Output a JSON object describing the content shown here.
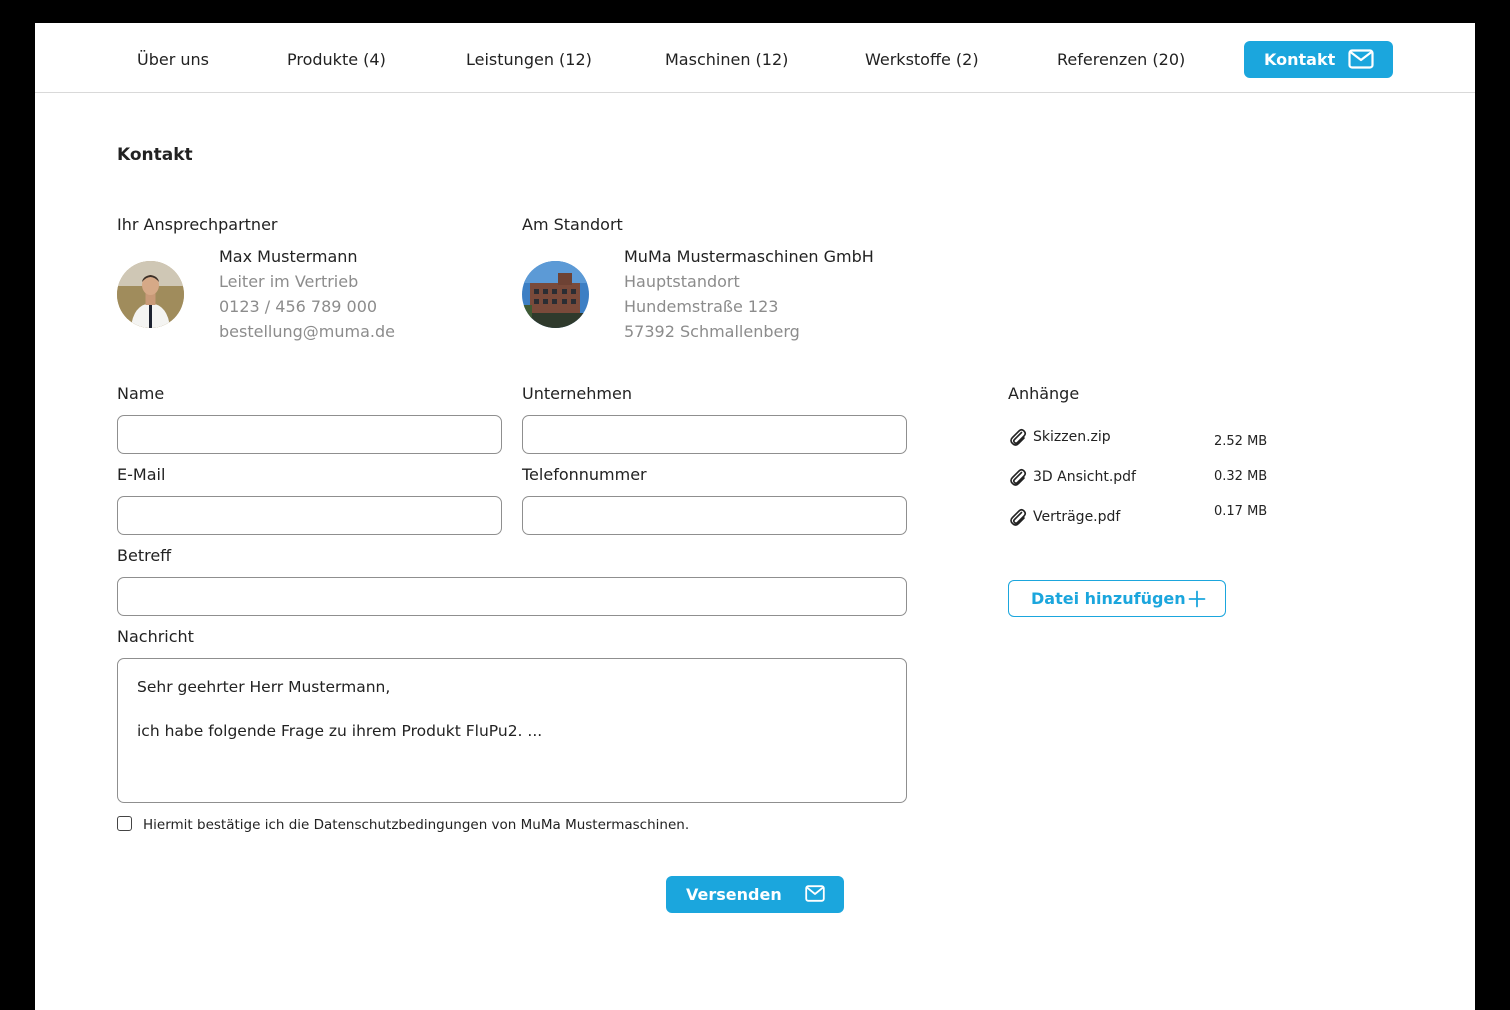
{
  "nav": {
    "items": [
      {
        "label": "Über uns"
      },
      {
        "label": "Produkte (4)"
      },
      {
        "label": "Leistungen (12)"
      },
      {
        "label": "Maschinen (12)"
      },
      {
        "label": "Werkstoffe (2)"
      },
      {
        "label": "Referenzen (20)"
      }
    ],
    "kontakt_label": "Kontakt",
    "kontakt_icon": "envelope-icon",
    "accent_color": "#1ba6dd"
  },
  "page": {
    "title": "Kontakt"
  },
  "contact_person": {
    "heading": "Ihr Ansprechpartner",
    "name": "Max Mustermann",
    "role": "Leiter im Vertrieb",
    "phone": "0123 / 456 789 000",
    "email": "bestellung@muma.de"
  },
  "location": {
    "heading": "Am Standort",
    "company": "MuMa Mustermaschinen GmbH",
    "site": "Hauptstandort",
    "street": "Hundemstraße 123",
    "city": "57392 Schmallenberg"
  },
  "form": {
    "name_label": "Name",
    "company_label": "Unternehmen",
    "email_label": "E-Mail",
    "phone_label": "Telefonnummer",
    "subject_label": "Betreff",
    "message_label": "Nachricht",
    "name_value": "",
    "company_value": "",
    "email_value": "",
    "phone_value": "",
    "subject_value": "",
    "message_line1": "Sehr geehrter Herr Mustermann,",
    "message_line2": "ich habe folgende Frage zu ihrem Produkt FluPu2. ...",
    "consent_text": "Hiermit bestätige ich die Datenschutzbedingungen von MuMa Mustermaschinen.",
    "consent_checked": false,
    "send_label": "Versenden",
    "send_icon": "envelope-icon"
  },
  "attachments": {
    "heading": "Anhänge",
    "files": [
      {
        "name": "Skizzen.zip",
        "size": "2.52 MB",
        "icon": "paperclip-icon"
      },
      {
        "name": "3D Ansicht.pdf",
        "size": "0.32 MB",
        "icon": "paperclip-icon"
      },
      {
        "name": "Verträge.pdf",
        "size": "0.17 MB",
        "icon": "paperclip-icon"
      }
    ],
    "add_label": "Datei hinzufügen",
    "add_icon": "plus-icon"
  }
}
